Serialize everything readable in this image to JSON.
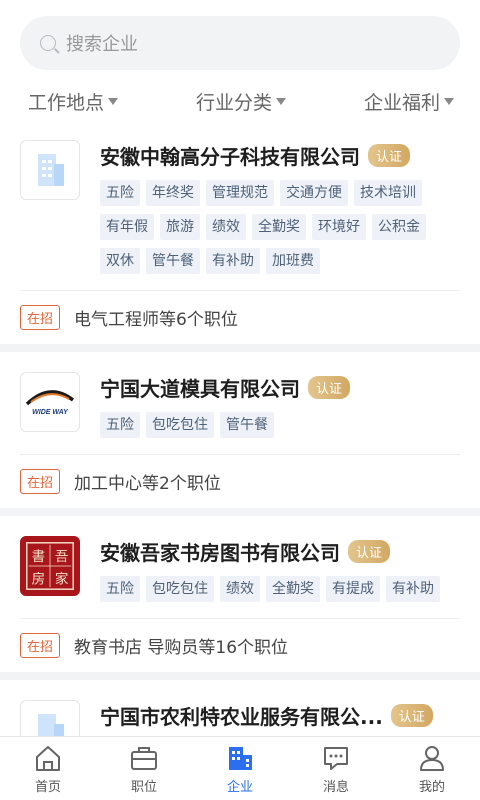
{
  "search": {
    "placeholder": "搜索企业"
  },
  "filters": [
    {
      "label": "工作地点"
    },
    {
      "label": "行业分类"
    },
    {
      "label": "企业福利"
    }
  ],
  "companies": [
    {
      "name": "安徽中翰高分子科技有限公司",
      "badge": "认证",
      "logo": "building-icon",
      "tags": [
        "五险",
        "年终奖",
        "管理规范",
        "交通方便",
        "技术培训",
        "有年假",
        "旅游",
        "绩效",
        "全勤奖",
        "环境好",
        "公积金",
        "双休",
        "管午餐",
        "有补助",
        "加班费"
      ],
      "hiring": "在招",
      "jobs": "电气工程师等6个职位"
    },
    {
      "name": "宁国大道模具有限公司",
      "badge": "认证",
      "logo": "wide-way-logo",
      "logo_text": "WIDE WAY",
      "tags": [
        "五险",
        "包吃包住",
        "管午餐"
      ],
      "hiring": "在招",
      "jobs": "加工中心等2个职位"
    },
    {
      "name": "安徽吾家书房图书有限公司",
      "badge": "认证",
      "logo": "seal-logo",
      "logo_text": "吾家书房",
      "tags": [
        "五险",
        "包吃包住",
        "绩效",
        "全勤奖",
        "有提成",
        "有补助"
      ],
      "hiring": "在招",
      "jobs": "教育书店 导购员等16个职位"
    },
    {
      "name": "宁国市农利特农业服务有限公...",
      "badge": "认证",
      "logo": "building-icon",
      "tags": [],
      "hiring": "",
      "jobs": ""
    }
  ],
  "tabbar": [
    {
      "label": "首页",
      "icon": "home-icon",
      "active": false
    },
    {
      "label": "职位",
      "icon": "briefcase-icon",
      "active": false
    },
    {
      "label": "企业",
      "icon": "company-icon",
      "active": true
    },
    {
      "label": "消息",
      "icon": "message-icon",
      "active": false
    },
    {
      "label": "我的",
      "icon": "profile-icon",
      "active": false
    }
  ],
  "colors": {
    "accent": "#2b6ff0",
    "hiring": "#e2663b",
    "badge": "#d9b271",
    "tag_bg": "#eef2f8"
  }
}
